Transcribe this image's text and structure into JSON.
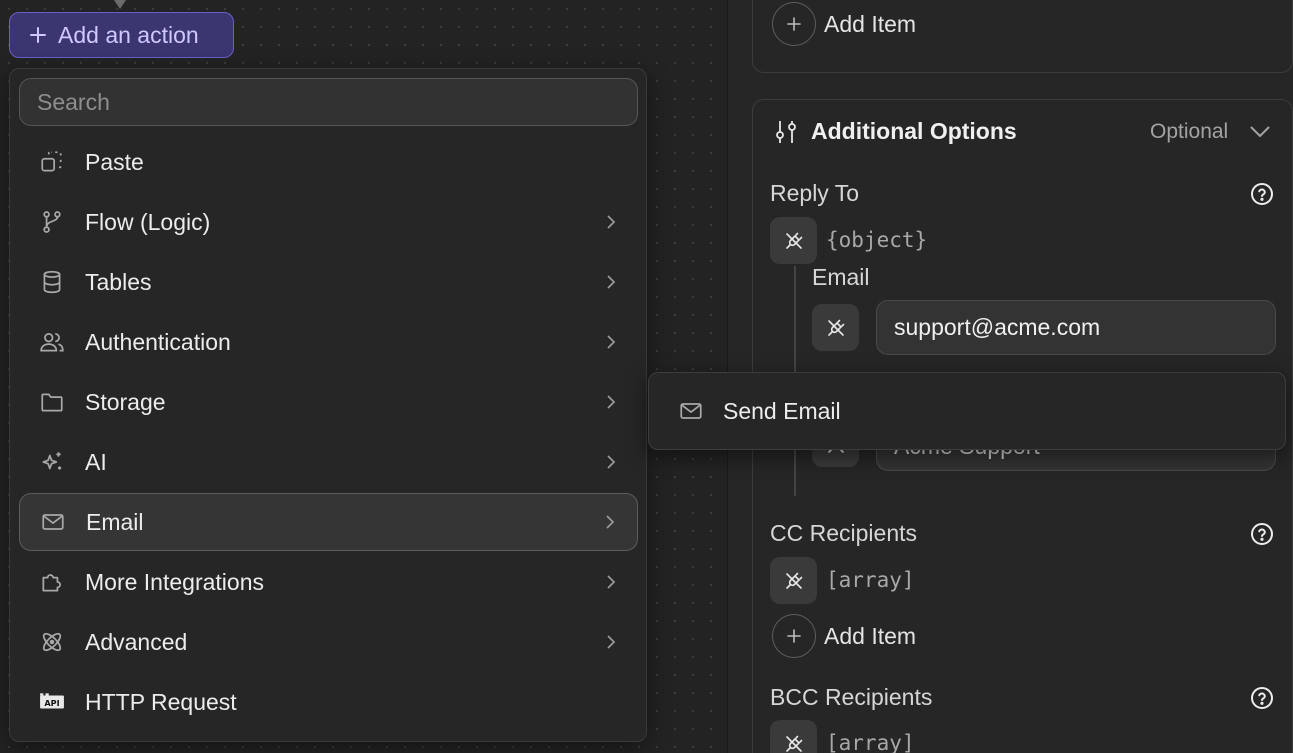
{
  "toolbar": {
    "add_action_label": "Add an action"
  },
  "menu": {
    "search_placeholder": "Search",
    "items": [
      {
        "label": "Paste",
        "icon": "paste-icon",
        "has_submenu": false
      },
      {
        "label": "Flow (Logic)",
        "icon": "git-branch-icon",
        "has_submenu": true
      },
      {
        "label": "Tables",
        "icon": "database-icon",
        "has_submenu": true
      },
      {
        "label": "Authentication",
        "icon": "users-icon",
        "has_submenu": true
      },
      {
        "label": "Storage",
        "icon": "folder-icon",
        "has_submenu": true
      },
      {
        "label": "AI",
        "icon": "sparkles-icon",
        "has_submenu": true
      },
      {
        "label": "Email",
        "icon": "mail-icon",
        "has_submenu": true,
        "active": true
      },
      {
        "label": "More Integrations",
        "icon": "puzzle-icon",
        "has_submenu": true
      },
      {
        "label": "Advanced",
        "icon": "atom-icon",
        "has_submenu": true
      },
      {
        "label": "HTTP Request",
        "icon": "api-icon",
        "has_submenu": false
      }
    ]
  },
  "submenu": {
    "items": [
      {
        "label": "Send Email",
        "icon": "mail-icon"
      }
    ]
  },
  "panel": {
    "top_add_item_label": "Add Item",
    "additional_options": {
      "title": "Additional Options",
      "badge": "Optional",
      "reply_to": {
        "label": "Reply To",
        "type_hint": "{object}",
        "email_label": "Email",
        "email_value": "support@acme.com",
        "name_value_partial": "Acme Support"
      },
      "cc": {
        "label": "CC Recipients",
        "type_hint": "[array]",
        "add_item_label": "Add Item"
      },
      "bcc": {
        "label": "BCC Recipients",
        "type_hint": "[array]"
      }
    }
  },
  "colors": {
    "accent_bg": "#3b3570",
    "accent_border": "#6a5fc9",
    "accent_text": "#cfc9ff",
    "panel_bg": "#262626"
  }
}
